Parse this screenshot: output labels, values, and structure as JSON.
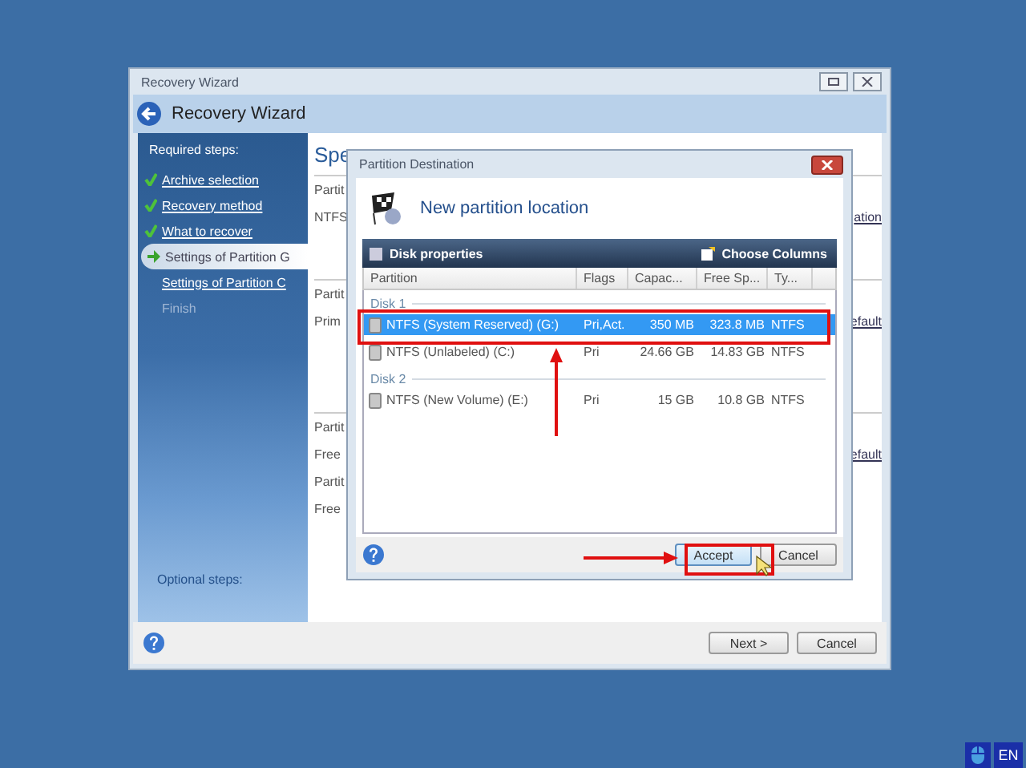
{
  "main_window": {
    "title": "Recovery Wizard",
    "header": "Recovery Wizard",
    "sidebar": {
      "heading": "Required steps:",
      "steps": [
        {
          "label": "Archive selection",
          "completed": true,
          "selected": false,
          "disabled": false
        },
        {
          "label": "Recovery method",
          "completed": true,
          "selected": false,
          "disabled": false
        },
        {
          "label": "What to recover",
          "completed": true,
          "selected": false,
          "disabled": false
        },
        {
          "label": "Settings of Partition G",
          "completed": false,
          "selected": true,
          "disabled": false
        },
        {
          "label": "Settings of Partition C",
          "completed": false,
          "selected": false,
          "disabled": false
        },
        {
          "label": "Finish",
          "completed": false,
          "selected": false,
          "disabled": true
        }
      ],
      "optional_heading": "Optional steps:"
    },
    "content": {
      "title": "Spe",
      "sections": [
        {
          "rows": [
            {
              "label": "Partit"
            },
            {
              "label": "NTFS",
              "link": "ation"
            }
          ]
        },
        {
          "rows": [
            {
              "label": "Partit"
            },
            {
              "label": "Prim",
              "link": "efault"
            }
          ]
        },
        {
          "rows": [
            {
              "label": "Partit"
            },
            {
              "label": "Free",
              "link": "efault"
            },
            {
              "label": "Partit"
            },
            {
              "label": "Free"
            }
          ]
        }
      ]
    },
    "buttons": [
      {
        "label": "Next >"
      },
      {
        "label": "Cancel"
      }
    ]
  },
  "dialog": {
    "title": "Partition Destination",
    "heading": "New partition location",
    "toolbar": {
      "left": "Disk properties",
      "right": "Choose Columns"
    },
    "columns": [
      "Partition",
      "Flags",
      "Capac...",
      "Free Sp...",
      "Ty..."
    ],
    "groups": [
      {
        "name": "Disk 1",
        "rows": [
          {
            "partition": "NTFS (System Reserved) (G:)",
            "flags": "Pri,Act.",
            "capacity": "350 MB",
            "free": "323.8 MB",
            "type": "NTFS",
            "selected": true
          },
          {
            "partition": "NTFS (Unlabeled) (C:)",
            "flags": "Pri",
            "capacity": "24.66 GB",
            "free": "14.83 GB",
            "type": "NTFS",
            "selected": false
          }
        ]
      },
      {
        "name": "Disk 2",
        "rows": [
          {
            "partition": "NTFS (New Volume) (E:)",
            "flags": "Pri",
            "capacity": "15 GB",
            "free": "10.8 GB",
            "type": "NTFS",
            "selected": false
          }
        ]
      }
    ],
    "buttons": [
      {
        "label": "Accept",
        "kind": "default"
      },
      {
        "label": "Cancel",
        "kind": "normal"
      }
    ]
  },
  "tray": {
    "language": "EN"
  }
}
